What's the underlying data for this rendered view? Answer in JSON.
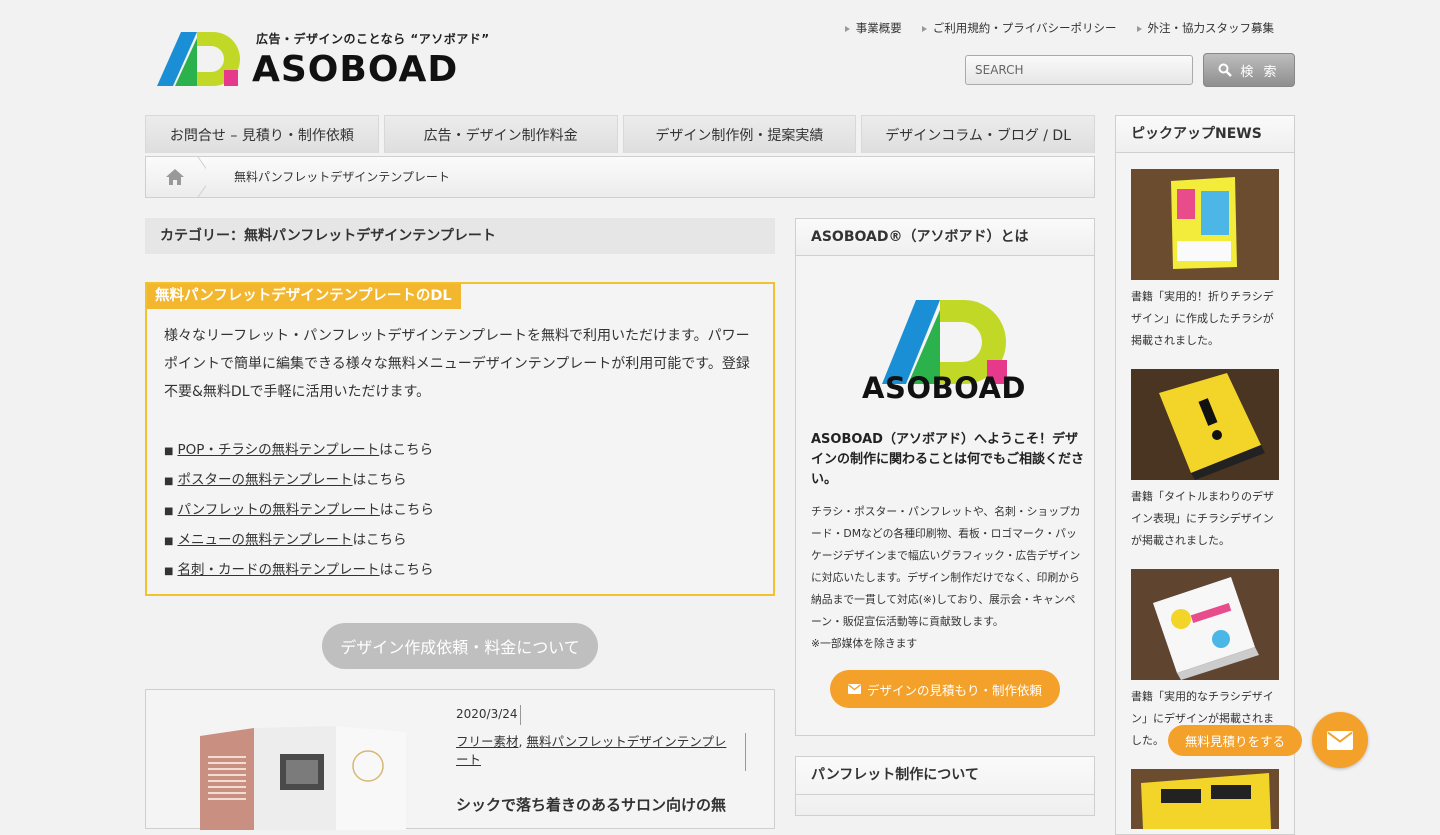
{
  "header": {
    "tagline": "広告・デザインのことなら “アソボアド”",
    "logo_word": "ASOBOAD",
    "top_links": [
      "事業概要",
      "ご利用規約・プライバシーポリシー",
      "外注・協力スタッフ募集"
    ],
    "search_placeholder": "SEARCH",
    "search_button": "検 索"
  },
  "nav": [
    "お問合せ – 見積り・制作依頼",
    "広告・デザイン制作料金",
    "デザイン制作例・提案実績",
    "デザインコラム・ブログ / DL"
  ],
  "breadcrumb": {
    "current": "無料パンフレットデザインテンプレート"
  },
  "category_title": "カテゴリー：無料パンフレットデザインテンプレート",
  "dl_box": {
    "label": "無料パンフレットデザインテンプレートのDL",
    "text": "様々なリーフレット・パンフレットデザインテンプレートを無料で利用いただけます。パワーポイントで簡単に編集できる様々な無料メニューデザインテンプレートが利用可能です。登録不要&無料DLで手軽に活用いただけます。",
    "links": [
      {
        "link": "POP・チラシの無料テンプレート",
        "suffix": "はこちら"
      },
      {
        "link": "ポスターの無料テンプレート",
        "suffix": "はこちら"
      },
      {
        "link": "パンフレットの無料テンプレート",
        "suffix": "はこちら"
      },
      {
        "link": "メニューの無料テンプレート",
        "suffix": "はこちら"
      },
      {
        "link": "名刺・カードの無料テンプレート",
        "suffix": "はこちら"
      }
    ]
  },
  "pill_button": "デザイン作成依頼・料金について",
  "post": {
    "date": "2020/3/24",
    "cat1": "フリー素材",
    "sep": ", ",
    "cat2": "無料パンフレットデザインテンプレート",
    "title": "シックで落ち着きのあるサロン向けの無"
  },
  "about": {
    "heading": "ASOBOAD®（アソボアド）とは",
    "logo_word": "ASOBOAD",
    "lead": "ASOBOAD（アソボアド）へようこそ！デザインの制作に関わることは何でもご相談ください。",
    "body": "チラシ・ポスター・パンフレットや、名刺・ショップカード・DMなどの各種印刷物、看板・ロゴマーク・パッケージデザインまで幅広いグラフィック・広告デザインに対応いたします。デザイン制作だけでなく、印刷から納品まで一貫して対応(※)しており、展示会・キャンペーン・販促宣伝活動等に貢献致します。",
    "note": "※一部媒体を除きます",
    "button": "デザインの見積もり・制作依頼"
  },
  "pamphlet": {
    "heading": "パンフレット制作について"
  },
  "pickup": {
    "heading": "ピックアップNEWS",
    "items": [
      {
        "text": "書籍「実用的！折りチラシデザイン」に作成したチラシが掲載されました。"
      },
      {
        "text": "書籍「タイトルまわりのデザイン表現」にチラシデザインが掲載されました。"
      },
      {
        "text": "書籍「実用的なチラシデザイン」にデザインが掲載されました。"
      }
    ]
  },
  "floating": {
    "button": "無料見積りをする"
  },
  "colors": {
    "accent": "#f4a12b",
    "box_border": "#f2c12e"
  }
}
